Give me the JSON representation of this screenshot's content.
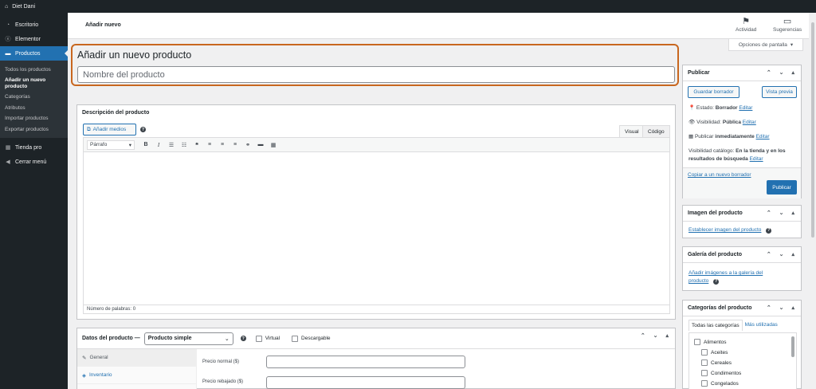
{
  "adminbar": {
    "site": "Diet Dani"
  },
  "sidebar": {
    "items": [
      {
        "label": "Escritorio",
        "icon": "dashboard-icon"
      },
      {
        "label": "Elementor",
        "icon": "elementor-icon"
      },
      {
        "label": "Productos",
        "icon": "products-icon"
      }
    ],
    "submenu": [
      "Todos los productos",
      "Añadir un nuevo producto",
      "Categorías",
      "Atributos",
      "Importar productos",
      "Exportar productos"
    ],
    "extra": [
      {
        "label": "Tienda pro",
        "icon": "store-icon"
      },
      {
        "label": "Cerrar menú",
        "icon": "collapse-icon"
      }
    ]
  },
  "topbar": {
    "title": "Añadir nuevo",
    "activity": "Actividad",
    "suggestions": "Sugerencias",
    "screen_options": "Opciones de pantalla"
  },
  "title_box": {
    "heading": "Añadir un nuevo producto",
    "placeholder": "Nombre del producto"
  },
  "description": {
    "header": "Descripción del producto",
    "add_media": "Añadir medios",
    "tab_visual": "Visual",
    "tab_code": "Código",
    "format": "Párrafo",
    "word_count": "Número de palabras: 0"
  },
  "product_data": {
    "label": "Datos del producto —",
    "type": "Producto simple",
    "virtual": "Virtual",
    "downloadable": "Descargable",
    "tabs": [
      "General",
      "Inventario"
    ],
    "regular_price": "Precio normal ($)",
    "sale_price": "Precio rebajado ($)"
  },
  "publish": {
    "title": "Publicar",
    "save_draft": "Guardar borrador",
    "preview": "Vista previa",
    "status_label": "Estado:",
    "status_value": "Borrador",
    "visibility_label": "Visibilidad:",
    "visibility_value": "Pública",
    "publish_label": "Publicar",
    "publish_value": "inmediatamente",
    "catalog_label": "Visibilidad catálogo:",
    "catalog_value": "En la tienda y en los resultados de búsqueda",
    "edit": "Editar",
    "copy_draft": "Copiar a un nuevo borrador",
    "publish_button": "Publicar"
  },
  "product_image": {
    "title": "Imagen del producto",
    "link": "Establecer imagen del producto"
  },
  "gallery": {
    "title": "Galería del producto",
    "link": "Añadir imágenes a la galería del producto"
  },
  "categories": {
    "title": "Categorías del producto",
    "tab_all": "Todas las categorías",
    "tab_used": "Más utilizadas",
    "items": [
      "Alimentos",
      "Aceites",
      "Cereales",
      "Condimentos",
      "Congelados"
    ]
  }
}
